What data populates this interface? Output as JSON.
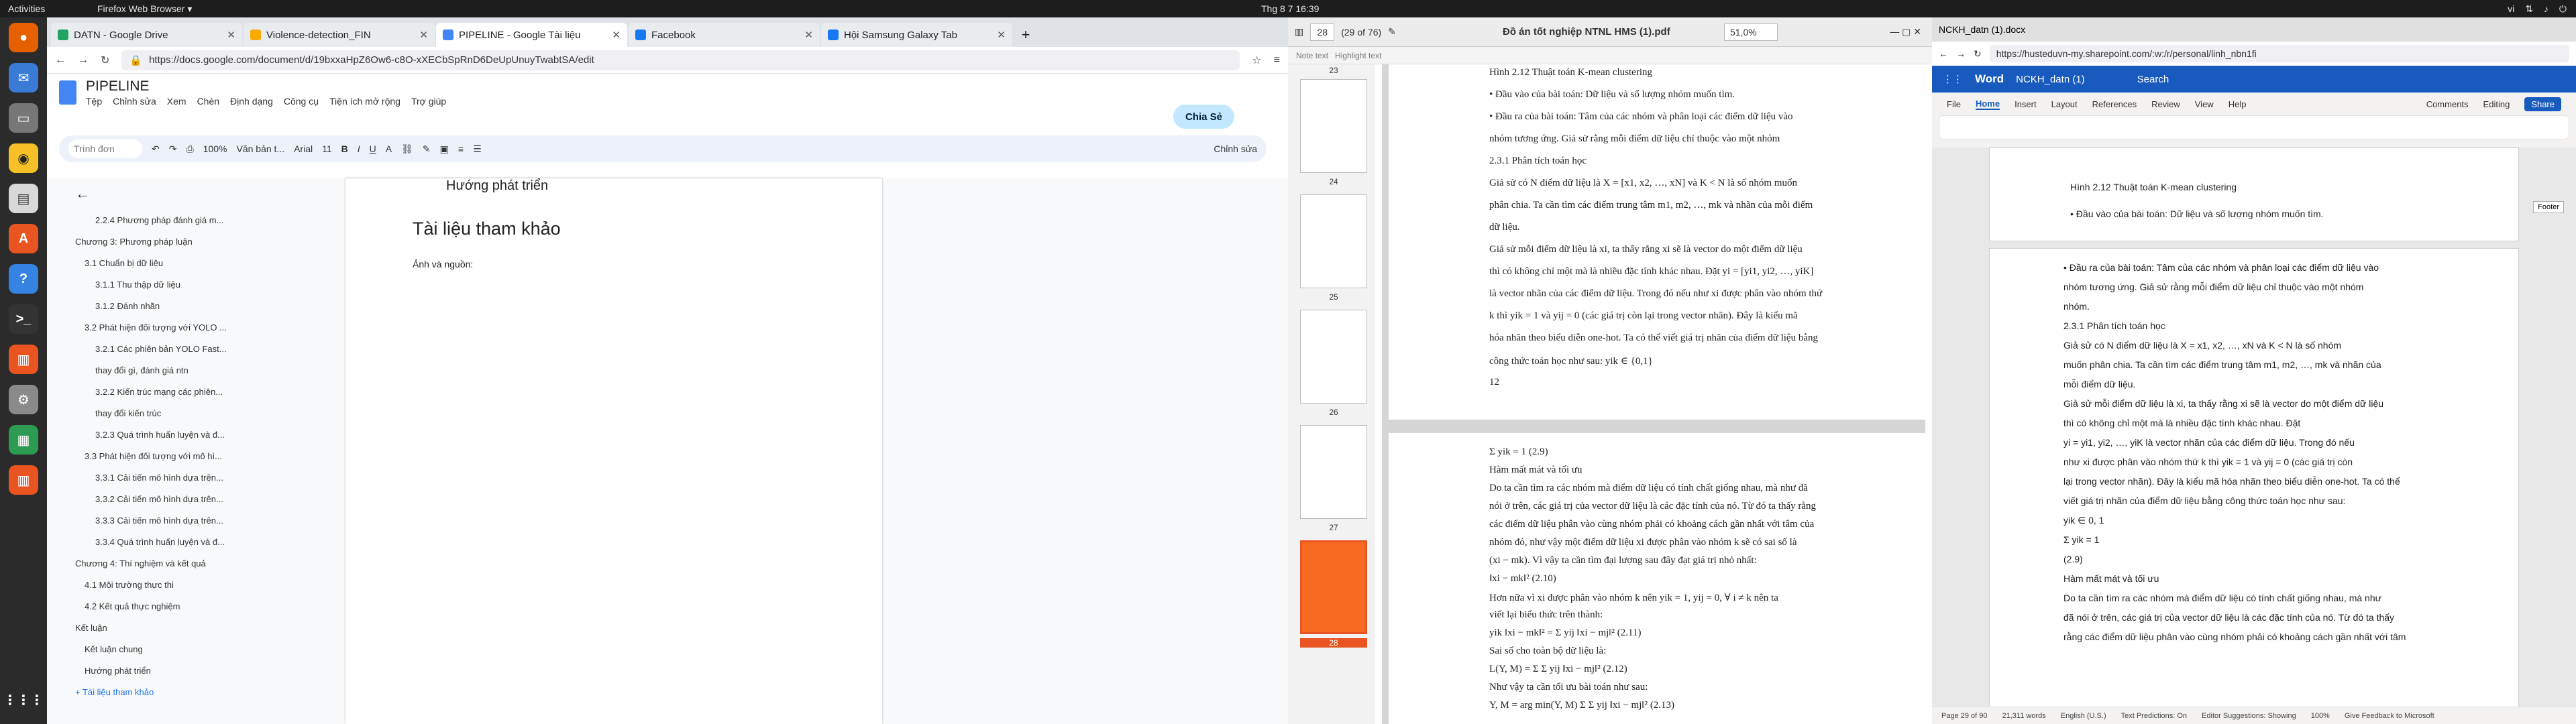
{
  "system": {
    "activities": "Activities",
    "current_app": "Firefox Web Browser ▾",
    "clock": "Thg 8 7  16:39",
    "lang": "vi"
  },
  "firefox": {
    "tabs": [
      {
        "label": "DATN - Google Drive",
        "color": "#1fa463"
      },
      {
        "label": "Violence-detection_FIN",
        "color": "#f9ab00"
      },
      {
        "label": "PIPELINE - Google Tài liệu",
        "color": "#4285f4"
      },
      {
        "label": "Facebook",
        "color": "#1877f2"
      },
      {
        "label": "Hội Samsung Galaxy Tab",
        "color": "#1877f2"
      }
    ],
    "url": "https://docs.google.com/document/d/19bxxaHpZ6Ow6-c8O-xXECbSpRnD6DeUpUnuyTwabtSA/edit"
  },
  "docs": {
    "doc_name": "PIPELINE",
    "menus": [
      "Tệp",
      "Chỉnh sửa",
      "Xem",
      "Chèn",
      "Định dạng",
      "Công cụ",
      "Tiện ích mở rộng",
      "Trợ giúp"
    ],
    "share": "Chia Sẻ",
    "toolbar": {
      "search": "Trình đơn",
      "zoom": "100%",
      "style": "Văn bản t...",
      "font": "Arial",
      "size": "11",
      "edit_mode": "Chỉnh sửa"
    },
    "outline": [
      {
        "label": "2.2.4 Phương pháp đánh giá m...",
        "level": "l3"
      },
      {
        "label": "Chương 3: Phương pháp luận",
        "level": "l1"
      },
      {
        "label": "3.1 Chuẩn bị dữ liệu",
        "level": "l2"
      },
      {
        "label": "3.1.1 Thu thập dữ liệu",
        "level": "l3"
      },
      {
        "label": "3.1.2 Đánh nhãn",
        "level": "l3"
      },
      {
        "label": "3.2 Phát hiện đối tượng với YOLO ...",
        "level": "l2"
      },
      {
        "label": "3.2.1 Các phiên bản YOLO Fast...",
        "level": "l3"
      },
      {
        "label": "thay đổi gì, đánh giá ntn",
        "level": "l3"
      },
      {
        "label": "3.2.2 Kiến trúc mạng các phiên...",
        "level": "l3"
      },
      {
        "label": "thay đổi kiến trúc",
        "level": "l3"
      },
      {
        "label": "3.2.3 Quá trình huấn luyện và đ...",
        "level": "l3"
      },
      {
        "label": "3.3 Phát hiện đối tượng với mô hì...",
        "level": "l2"
      },
      {
        "label": "3.3.1 Cải tiến mô hình dựa trên...",
        "level": "l3"
      },
      {
        "label": "3.3.2 Cải tiến mô hình dựa trên...",
        "level": "l3"
      },
      {
        "label": "3.3.3 Cải tiến mô hình dựa trên...",
        "level": "l3"
      },
      {
        "label": "3.3.4 Quá trình huấn luyện và đ...",
        "level": "l3"
      },
      {
        "label": "Chương 4: Thí nghiệm và kết quả",
        "level": "l1"
      },
      {
        "label": "4.1 Môi trường thực thi",
        "level": "l2"
      },
      {
        "label": "4.2 Kết quả thực nghiệm",
        "level": "l2"
      },
      {
        "label": "Kết luận",
        "level": "l1"
      },
      {
        "label": "Kết luận chung",
        "level": "l2"
      },
      {
        "label": "Hướng phát triển",
        "level": "l2"
      }
    ],
    "outline_link": "+ Tài liệu tham khảo",
    "page": {
      "heading1": "Hướng phát triển",
      "heading2": "Tài liệu tham khảo",
      "para": "Ảnh và nguồn:"
    }
  },
  "pdf": {
    "page_num": "28",
    "page_of": "(29 of 76)",
    "title": "Đồ án tốt nghiệp NTNL HMS (1).pdf",
    "zoom": "51,0%",
    "sub_tabs": [
      "Note text",
      "Highlight text"
    ],
    "thumb_labels": [
      "23",
      "24",
      "25",
      "26",
      "27",
      "28"
    ],
    "page1_lines": [
      "Hình 2.12 Thuật toán K-mean clustering",
      "•  Đầu vào của bài toán: Dữ liệu và số lượng nhóm muốn tìm.",
      "•  Đầu ra của bài toán: Tâm của các nhóm và phân loại các điểm dữ liệu vào",
      "    nhóm tương ứng. Giả sử rằng mỗi điểm dữ liệu chỉ thuộc vào một nhóm",
      "2.3.1 Phân tích toán học",
      "Giả sử có N điểm dữ liệu là X = [x1, x2, …, xN] và K < N là số nhóm muốn",
      "phân chia. Ta cần tìm các điểm trung tâm m1, m2, …, mk và nhãn của mỗi điểm",
      "dữ liệu.",
      "Giả sử mỗi điểm dữ liệu là xi, ta thấy rằng xi sẽ là vector do một điểm dữ liệu",
      "thì có không chỉ một mà là nhiều đặc tính khác nhau. Đặt yi = [yi1, yi2, …, yiK]",
      "là vector nhãn của các điểm dữ liệu. Trong đó nếu như xi được phân vào nhóm thứ",
      "k thì yik = 1 và yij = 0 (các giá trị còn lại trong vector nhãn). Đây là kiểu mã",
      "hóa nhãn theo biểu diễn one-hot. Ta có thể viết giá trị nhãn của điểm dữ liệu bằng",
      "công thức toán học như sau: yik ∈ {0,1}",
      "12"
    ],
    "page2_lines": [
      "Σ yik = 1                                                  (2.9)",
      "Hàm mất mát và tối ưu",
      "Do ta cần tìm ra các nhóm mà điểm dữ liệu có tính chất giống nhau, mà như đã",
      "nói ở trên, các giá trị của vector dữ liệu là các đặc tính của nó. Từ đó ta thấy rằng",
      "các điểm dữ liệu phân vào cùng nhóm phải có khoảng cách gần nhất với tâm của",
      "nhóm đó, như vậy một điểm dữ liệu xi được phân vào nhóm k sẽ có sai số là",
      "(xi − mk). Vì vậy ta cần tìm đại lượng sau đây đạt giá trị nhỏ nhất:",
      "‖xi − mk‖²                                                  (2.10)",
      "Hơn nữa vì xi được phân vào nhóm k nên yik = 1, yij = 0, ∀ i ≠ k nên ta",
      "viết lại biểu thức trên thành:",
      "yik ‖xi − mk‖² = Σ yij ‖xi − mj‖²                           (2.11)",
      "Sai số cho toàn bộ dữ liệu là:",
      "L(Y, M) = Σ Σ yij ‖xi − mj‖²                                (2.12)",
      "Như vậy ta cần tối ưu bài toán như sau:",
      "Y, M = arg min(Y, M) Σ Σ yij ‖xi − mj‖²                    (2.13)"
    ]
  },
  "word": {
    "tab": "NCKH_datn (1).docx",
    "url": "https://husteduvn-my.sharepoint.com/:w:/r/personal/linh_nbn1fi",
    "app": "Word",
    "doc": "NCKH_datn (1)",
    "search": "Search",
    "menus": [
      "File",
      "Home",
      "Insert",
      "Layout",
      "References",
      "Review",
      "View",
      "Help"
    ],
    "comments": "Comments",
    "editing": "Editing",
    "share": "Share",
    "page1_lines": [
      "Hình 2.12 Thuật toán K-mean clustering",
      "•  Đầu vào của bài toán: Dữ liệu và số lượng nhóm muốn tìm."
    ],
    "page2_lines": [
      "•  Đầu ra của bài toán: Tâm của các nhóm và phân loại các điểm dữ liệu vào",
      "    nhóm tương ứng. Giả sử rằng mỗi điểm dữ liệu chỉ thuộc vào một nhóm",
      "    nhóm.",
      "2.3.1 Phân tích toán học",
      "Giả sử có N điểm dữ liệu là X = x1, x2, …, xN và K < N là số nhóm",
      "muốn phân chia. Ta cần tìm các điểm trung tâm m1, m2, …, mk và nhãn của",
      "mỗi điểm dữ liệu.",
      "Giả sử mỗi điểm dữ liệu là xi, ta thấy rằng xi sẽ là vector do một điểm dữ liệu",
      "thì có không chỉ một mà là nhiều đặc tính khác nhau. Đặt",
      "yi = yi1, yi2, …, yiK là vector nhãn của các điểm dữ liệu. Trong đó nếu",
      "như xi được phân vào nhóm thứ k thì yik = 1 và yij = 0 (các giá trị còn",
      "lại trong vector nhãn). Đây là kiểu mã hóa nhãn theo biểu diễn one-hot. Ta có thể",
      "viết giá trị nhãn của điểm dữ liệu bằng công thức toán học như sau:",
      "yik ∈ 0, 1",
      "Σ yik = 1",
      "(2.9)",
      "Hàm mất mát và tối ưu",
      "Do ta cần tìm ra các nhóm mà điểm dữ liệu có tính chất giống nhau, mà như",
      "đã nói ở trên, các giá trị của vector dữ liệu là các đặc tính của nó. Từ đó ta thấy",
      "rằng các điểm dữ liệu phân vào cùng nhóm phải có khoảng cách gần nhất với tâm"
    ],
    "footer": "Footer",
    "status": [
      "Page 29 of 90",
      "21,311 words",
      "English (U.S.)",
      "Text Predictions: On",
      "Editor Suggestions: Showing",
      "100%",
      "Give Feedback to Microsoft"
    ]
  }
}
